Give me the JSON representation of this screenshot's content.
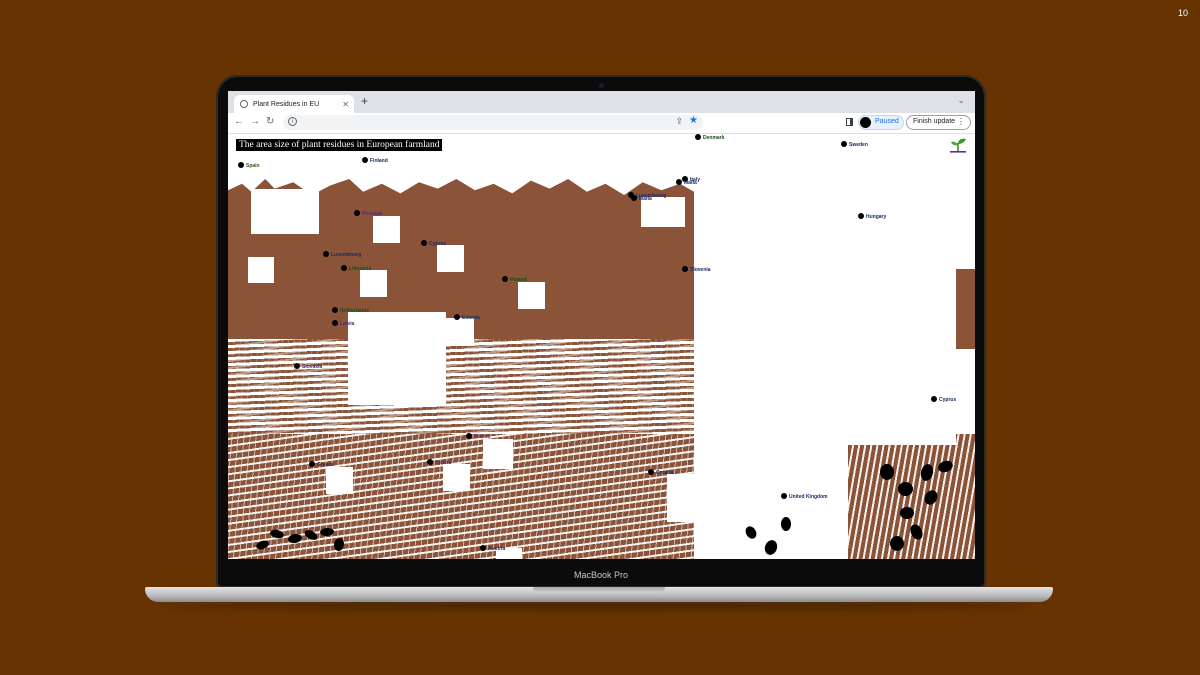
{
  "slide": {
    "number": "10"
  },
  "device": {
    "label": "MacBook Pro"
  },
  "browser": {
    "tab_title": "Plant Residues in EU",
    "paused_label": "Paused",
    "finish_update_label": "Finish update",
    "accent_color": "#1a73e8"
  },
  "page": {
    "heading": "The area size of plant residues in European farmland",
    "colors": {
      "background": "#ffffff",
      "residue": "#8b5439",
      "slide_bg": "#663300"
    }
  },
  "icons": [
    "globe-icon",
    "close-icon",
    "plus-icon",
    "chevron-down-icon",
    "back-arrow-icon",
    "forward-arrow-icon",
    "reload-icon",
    "info-icon",
    "share-icon",
    "star-icon",
    "side-panel-icon",
    "avatar-icon",
    "kebab-menu-icon",
    "sprout-logo-icon"
  ],
  "countries": [
    {
      "name": "Denmark",
      "color": "#1a4d1a"
    },
    {
      "name": "Sweden",
      "color": "#1a2b66"
    },
    {
      "name": "Spain",
      "color": "#3b5a1a"
    },
    {
      "name": "Finland",
      "color": "#1a2b66"
    },
    {
      "name": "Italy",
      "color": "#1a2b66"
    },
    {
      "name": "Malta",
      "color": "#1a2b66"
    },
    {
      "name": "Luxembourg",
      "color": "#1a2b66"
    },
    {
      "name": "Malta",
      "color": "#1a2b66"
    },
    {
      "name": "Portugal",
      "color": "#5a2a66"
    },
    {
      "name": "Hungary",
      "color": "#1a2b66"
    },
    {
      "name": "Estonia",
      "color": "#1a2b66"
    },
    {
      "name": "Luxembourg",
      "color": "#1a2b66"
    },
    {
      "name": "Cyprus",
      "color": "#1a2b66"
    },
    {
      "name": "Lithuania",
      "color": "#1a4d1a"
    },
    {
      "name": "Slovenia",
      "color": "#1a2b66"
    },
    {
      "name": "Poland",
      "color": "#1a4d1a"
    },
    {
      "name": "Netherlands",
      "color": "#1a4d1a"
    },
    {
      "name": "Latvia",
      "color": "#5a2a66"
    },
    {
      "name": "Slovakia",
      "color": "#5a2a66"
    },
    {
      "name": "Cyprus",
      "color": "#1a2b66"
    },
    {
      "name": "France",
      "color": "#5a2a66"
    },
    {
      "name": "Greece",
      "color": "#1a2b66"
    },
    {
      "name": "Ireland",
      "color": "#5a2a66"
    },
    {
      "name": "Croatia",
      "color": "#1a2b66"
    },
    {
      "name": "United Kingdom",
      "color": "#1a2b66"
    },
    {
      "name": "Austria",
      "color": "#1a2b66"
    }
  ]
}
